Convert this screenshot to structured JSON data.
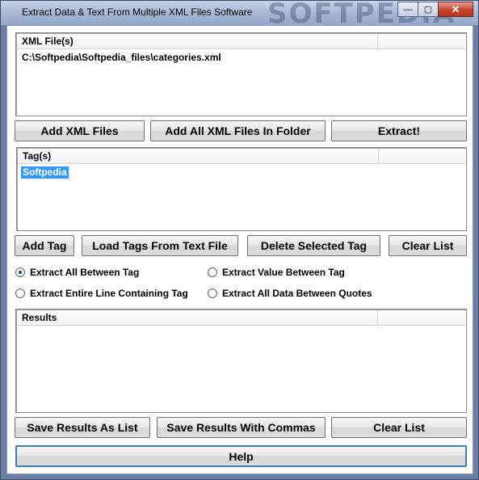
{
  "window": {
    "title": "Extract Data & Text From Multiple XML Files Software",
    "watermark": "SOFTPEDIA",
    "minimize_glyph": "—",
    "maximize_glyph": "▢",
    "close_glyph": "✕"
  },
  "xml_list": {
    "header": "XML File(s)",
    "rows": [
      "C:\\Softpedia\\Softpedia_files\\categories.xml"
    ]
  },
  "file_buttons": {
    "add_xml": "Add XML Files",
    "add_all": "Add All XML Files In Folder",
    "extract": "Extract!"
  },
  "tag_list": {
    "header": "Tag(s)",
    "rows": [
      "Softpedia"
    ]
  },
  "tag_buttons": {
    "add_tag": "Add Tag",
    "load_tags": "Load Tags From Text File",
    "delete_tag": "Delete Selected Tag",
    "clear_list": "Clear List"
  },
  "options": {
    "extract_all_between_tag": "Extract All Between Tag",
    "extract_value_between_tag": "Extract Value Between Tag",
    "extract_entire_line": "Extract Entire Line Containing Tag",
    "extract_all_between_quotes": "Extract All Data Between Quotes",
    "selected": "extract_all_between_tag"
  },
  "results_list": {
    "header": "Results",
    "rows": []
  },
  "result_buttons": {
    "save_list": "Save Results As List",
    "save_commas": "Save Results With Commas",
    "clear_list": "Clear List"
  },
  "help_button": "Help",
  "colors": {
    "selection": "#3399ff",
    "default_button_border": "#3c7fb1",
    "close_button": "#c7432e"
  }
}
